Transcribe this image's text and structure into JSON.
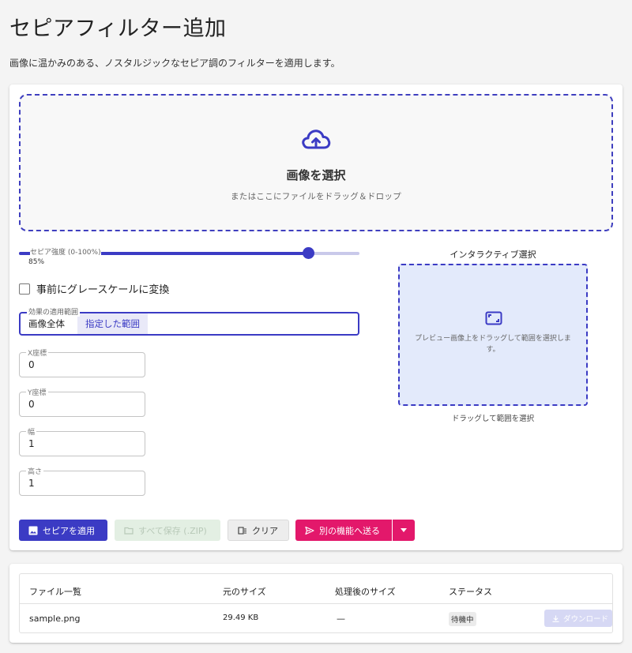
{
  "page": {
    "title": "セピアフィルター追加",
    "description": "画像に温かみのある、ノスタルジックなセピア調のフィルターを適用します。"
  },
  "upload": {
    "title": "画像を選択",
    "subtitle": "またはここにファイルをドラッグ＆ドロップ",
    "icon": "cloud-upload-icon"
  },
  "sepia_slider": {
    "label": "セピア強度 (0-100%)",
    "value_text": "85%",
    "value": 85,
    "min": 0,
    "max": 100
  },
  "grayscale_checkbox": {
    "label": "事前にグレースケールに変換",
    "checked": false
  },
  "scope": {
    "legend": "効果の適用範囲",
    "options": [
      "画像全体",
      "指定した範囲"
    ],
    "selected": "指定した範囲"
  },
  "fields": {
    "x": {
      "label": "X座標",
      "value": "0"
    },
    "y": {
      "label": "Y座標",
      "value": "0"
    },
    "width": {
      "label": "幅",
      "value": "1"
    },
    "height": {
      "label": "高さ",
      "value": "1"
    }
  },
  "interactive": {
    "title": "インタラクティブ選択",
    "hint": "プレビュー画像上をドラッグして範囲を選択します。",
    "caption": "ドラッグして範囲を選択",
    "icon": "aspect-ratio-icon"
  },
  "buttons": {
    "apply": "セピアを適用",
    "save_zip": "すべて保存 (.ZIP)",
    "clear": "クリア",
    "send": "別の機能へ送る"
  },
  "files_table": {
    "columns": [
      "ファイル一覧",
      "元のサイズ",
      "処理後のサイズ",
      "ステータス"
    ],
    "rows": [
      {
        "name": "sample.png",
        "original_size": "29.49 KB",
        "processed_size": "—",
        "status": "待機中",
        "action": "ダウンロード"
      }
    ]
  },
  "colors": {
    "primary": "#3b3bc4",
    "accent": "#e3186b",
    "disabled_green": "#e3efe3",
    "selection_bg": "#e3eafb"
  }
}
